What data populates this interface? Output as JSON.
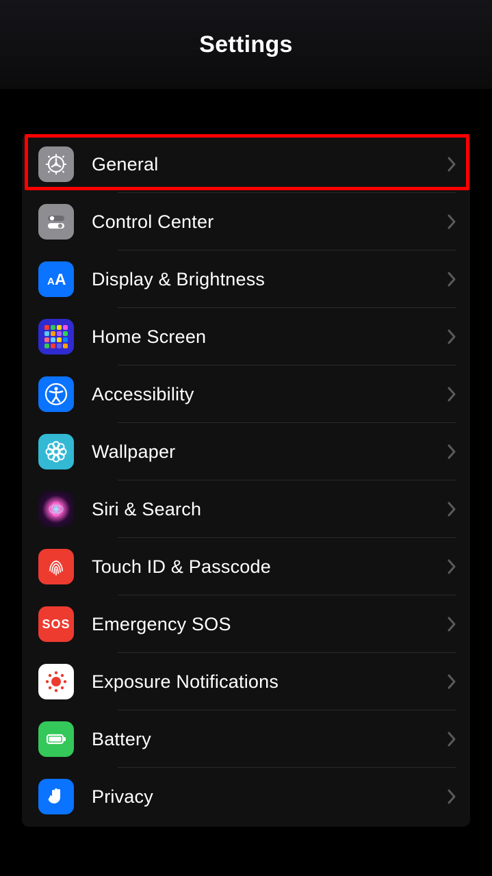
{
  "header": {
    "title": "Settings"
  },
  "highlight_index": 0,
  "items": [
    {
      "key": "general",
      "label": "General"
    },
    {
      "key": "control-center",
      "label": "Control Center"
    },
    {
      "key": "display",
      "label": "Display & Brightness"
    },
    {
      "key": "home",
      "label": "Home Screen"
    },
    {
      "key": "accessibility",
      "label": "Accessibility"
    },
    {
      "key": "wallpaper",
      "label": "Wallpaper"
    },
    {
      "key": "siri",
      "label": "Siri & Search"
    },
    {
      "key": "touchid",
      "label": "Touch ID & Passcode"
    },
    {
      "key": "sos",
      "label": "Emergency SOS",
      "badge": "SOS"
    },
    {
      "key": "exposure",
      "label": "Exposure Notifications"
    },
    {
      "key": "battery",
      "label": "Battery"
    },
    {
      "key": "privacy",
      "label": "Privacy"
    }
  ]
}
